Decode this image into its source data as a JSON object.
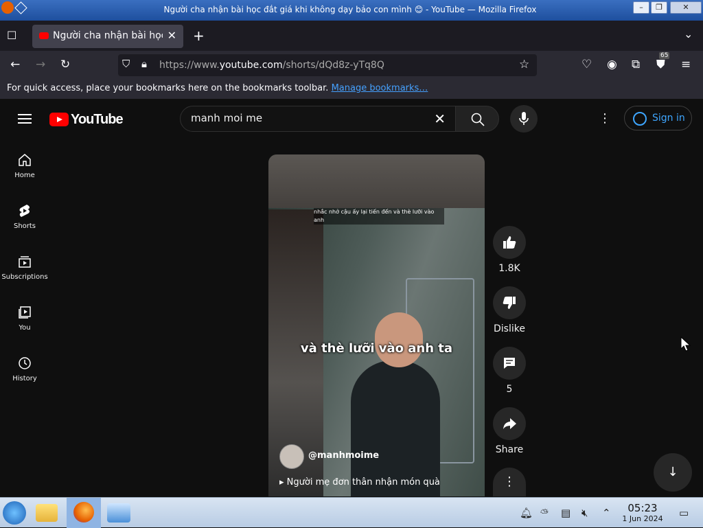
{
  "window": {
    "title": "Người cha nhận bài học đắt giá khi không dạy bảo con mình 😊 - YouTube — Mozilla Firefox"
  },
  "tabs": [
    {
      "label": "Người cha nhận bài học"
    }
  ],
  "nav": {
    "url_prefix": "https://www.",
    "url_domain": "youtube.com",
    "url_path": "/shorts/dQd8z-yTq8Q",
    "extension_badge": "65"
  },
  "bookmarks_bar": {
    "message": "For quick access, place your bookmarks here on the bookmarks toolbar.",
    "link": "Manage bookmarks…"
  },
  "youtube": {
    "logo": "YouTube",
    "search_value": "manh moi me",
    "sign_in": "Sign in",
    "sidebar": [
      {
        "label": "Home",
        "icon": "home-icon"
      },
      {
        "label": "Shorts",
        "icon": "shorts-icon"
      },
      {
        "label": "Subscriptions",
        "icon": "subscriptions-icon"
      },
      {
        "label": "You",
        "icon": "you-icon"
      },
      {
        "label": "History",
        "icon": "history-icon"
      }
    ],
    "short": {
      "caption": "và thè lưỡi vào anh ta",
      "small_subtitle": "nhắc nhở cậu ấy lại tiến đến và thè lưỡi vào anh",
      "channel": "@manhmoime",
      "title": "Người mẹ đơn thân nhận món quà"
    },
    "actions": {
      "likes": "1.8K",
      "dislike": "Dislike",
      "comments": "5",
      "share": "Share"
    }
  },
  "taskbar": {
    "time": "05:23",
    "date": "1 Jun 2024"
  }
}
